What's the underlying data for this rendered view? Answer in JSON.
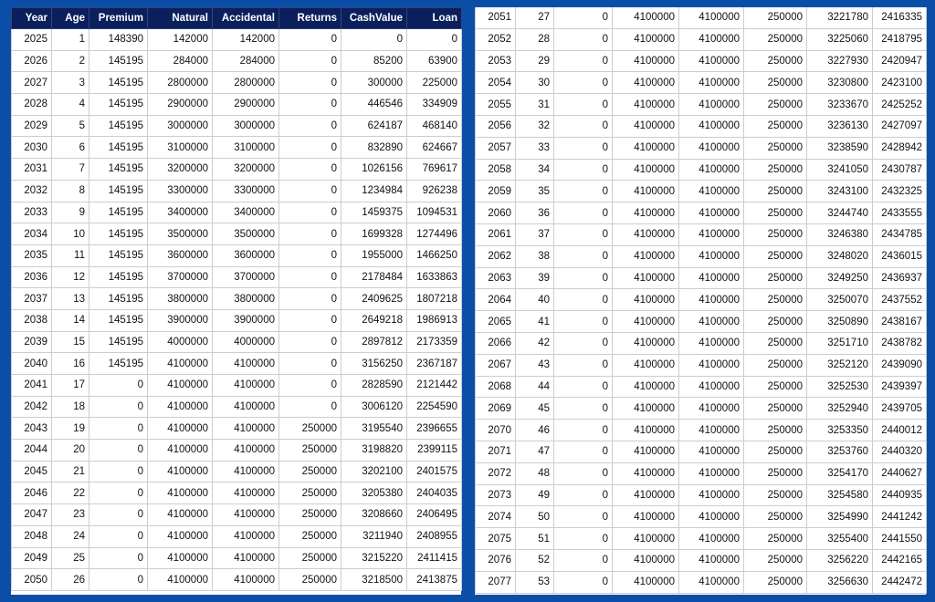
{
  "headers": [
    "Year",
    "Age",
    "Premium",
    "Natural",
    "Accidental",
    "Returns",
    "CashValue",
    "Loan"
  ],
  "left_rows": [
    [
      "2025",
      "1",
      "148390",
      "142000",
      "142000",
      "0",
      "0",
      "0"
    ],
    [
      "2026",
      "2",
      "145195",
      "284000",
      "284000",
      "0",
      "85200",
      "63900"
    ],
    [
      "2027",
      "3",
      "145195",
      "2800000",
      "2800000",
      "0",
      "300000",
      "225000"
    ],
    [
      "2028",
      "4",
      "145195",
      "2900000",
      "2900000",
      "0",
      "446546",
      "334909"
    ],
    [
      "2029",
      "5",
      "145195",
      "3000000",
      "3000000",
      "0",
      "624187",
      "468140"
    ],
    [
      "2030",
      "6",
      "145195",
      "3100000",
      "3100000",
      "0",
      "832890",
      "624667"
    ],
    [
      "2031",
      "7",
      "145195",
      "3200000",
      "3200000",
      "0",
      "1026156",
      "769617"
    ],
    [
      "2032",
      "8",
      "145195",
      "3300000",
      "3300000",
      "0",
      "1234984",
      "926238"
    ],
    [
      "2033",
      "9",
      "145195",
      "3400000",
      "3400000",
      "0",
      "1459375",
      "1094531"
    ],
    [
      "2034",
      "10",
      "145195",
      "3500000",
      "3500000",
      "0",
      "1699328",
      "1274496"
    ],
    [
      "2035",
      "11",
      "145195",
      "3600000",
      "3600000",
      "0",
      "1955000",
      "1466250"
    ],
    [
      "2036",
      "12",
      "145195",
      "3700000",
      "3700000",
      "0",
      "2178484",
      "1633863"
    ],
    [
      "2037",
      "13",
      "145195",
      "3800000",
      "3800000",
      "0",
      "2409625",
      "1807218"
    ],
    [
      "2038",
      "14",
      "145195",
      "3900000",
      "3900000",
      "0",
      "2649218",
      "1986913"
    ],
    [
      "2039",
      "15",
      "145195",
      "4000000",
      "4000000",
      "0",
      "2897812",
      "2173359"
    ],
    [
      "2040",
      "16",
      "145195",
      "4100000",
      "4100000",
      "0",
      "3156250",
      "2367187"
    ],
    [
      "2041",
      "17",
      "0",
      "4100000",
      "4100000",
      "0",
      "2828590",
      "2121442"
    ],
    [
      "2042",
      "18",
      "0",
      "4100000",
      "4100000",
      "0",
      "3006120",
      "2254590"
    ],
    [
      "2043",
      "19",
      "0",
      "4100000",
      "4100000",
      "250000",
      "3195540",
      "2396655"
    ],
    [
      "2044",
      "20",
      "0",
      "4100000",
      "4100000",
      "250000",
      "3198820",
      "2399115"
    ],
    [
      "2045",
      "21",
      "0",
      "4100000",
      "4100000",
      "250000",
      "3202100",
      "2401575"
    ],
    [
      "2046",
      "22",
      "0",
      "4100000",
      "4100000",
      "250000",
      "3205380",
      "2404035"
    ],
    [
      "2047",
      "23",
      "0",
      "4100000",
      "4100000",
      "250000",
      "3208660",
      "2406495"
    ],
    [
      "2048",
      "24",
      "0",
      "4100000",
      "4100000",
      "250000",
      "3211940",
      "2408955"
    ],
    [
      "2049",
      "25",
      "0",
      "4100000",
      "4100000",
      "250000",
      "3215220",
      "2411415"
    ],
    [
      "2050",
      "26",
      "0",
      "4100000",
      "4100000",
      "250000",
      "3218500",
      "2413875"
    ]
  ],
  "right_rows": [
    [
      "2051",
      "27",
      "0",
      "4100000",
      "4100000",
      "250000",
      "3221780",
      "2416335"
    ],
    [
      "2052",
      "28",
      "0",
      "4100000",
      "4100000",
      "250000",
      "3225060",
      "2418795"
    ],
    [
      "2053",
      "29",
      "0",
      "4100000",
      "4100000",
      "250000",
      "3227930",
      "2420947"
    ],
    [
      "2054",
      "30",
      "0",
      "4100000",
      "4100000",
      "250000",
      "3230800",
      "2423100"
    ],
    [
      "2055",
      "31",
      "0",
      "4100000",
      "4100000",
      "250000",
      "3233670",
      "2425252"
    ],
    [
      "2056",
      "32",
      "0",
      "4100000",
      "4100000",
      "250000",
      "3236130",
      "2427097"
    ],
    [
      "2057",
      "33",
      "0",
      "4100000",
      "4100000",
      "250000",
      "3238590",
      "2428942"
    ],
    [
      "2058",
      "34",
      "0",
      "4100000",
      "4100000",
      "250000",
      "3241050",
      "2430787"
    ],
    [
      "2059",
      "35",
      "0",
      "4100000",
      "4100000",
      "250000",
      "3243100",
      "2432325"
    ],
    [
      "2060",
      "36",
      "0",
      "4100000",
      "4100000",
      "250000",
      "3244740",
      "2433555"
    ],
    [
      "2061",
      "37",
      "0",
      "4100000",
      "4100000",
      "250000",
      "3246380",
      "2434785"
    ],
    [
      "2062",
      "38",
      "0",
      "4100000",
      "4100000",
      "250000",
      "3248020",
      "2436015"
    ],
    [
      "2063",
      "39",
      "0",
      "4100000",
      "4100000",
      "250000",
      "3249250",
      "2436937"
    ],
    [
      "2064",
      "40",
      "0",
      "4100000",
      "4100000",
      "250000",
      "3250070",
      "2437552"
    ],
    [
      "2065",
      "41",
      "0",
      "4100000",
      "4100000",
      "250000",
      "3250890",
      "2438167"
    ],
    [
      "2066",
      "42",
      "0",
      "4100000",
      "4100000",
      "250000",
      "3251710",
      "2438782"
    ],
    [
      "2067",
      "43",
      "0",
      "4100000",
      "4100000",
      "250000",
      "3252120",
      "2439090"
    ],
    [
      "2068",
      "44",
      "0",
      "4100000",
      "4100000",
      "250000",
      "3252530",
      "2439397"
    ],
    [
      "2069",
      "45",
      "0",
      "4100000",
      "4100000",
      "250000",
      "3252940",
      "2439705"
    ],
    [
      "2070",
      "46",
      "0",
      "4100000",
      "4100000",
      "250000",
      "3253350",
      "2440012"
    ],
    [
      "2071",
      "47",
      "0",
      "4100000",
      "4100000",
      "250000",
      "3253760",
      "2440320"
    ],
    [
      "2072",
      "48",
      "0",
      "4100000",
      "4100000",
      "250000",
      "3254170",
      "2440627"
    ],
    [
      "2073",
      "49",
      "0",
      "4100000",
      "4100000",
      "250000",
      "3254580",
      "2440935"
    ],
    [
      "2074",
      "50",
      "0",
      "4100000",
      "4100000",
      "250000",
      "3254990",
      "2441242"
    ],
    [
      "2075",
      "51",
      "0",
      "4100000",
      "4100000",
      "250000",
      "3255400",
      "2441550"
    ],
    [
      "2076",
      "52",
      "0",
      "4100000",
      "4100000",
      "250000",
      "3256220",
      "2442165"
    ],
    [
      "2077",
      "53",
      "0",
      "4100000",
      "4100000",
      "250000",
      "3256630",
      "2442472"
    ]
  ]
}
